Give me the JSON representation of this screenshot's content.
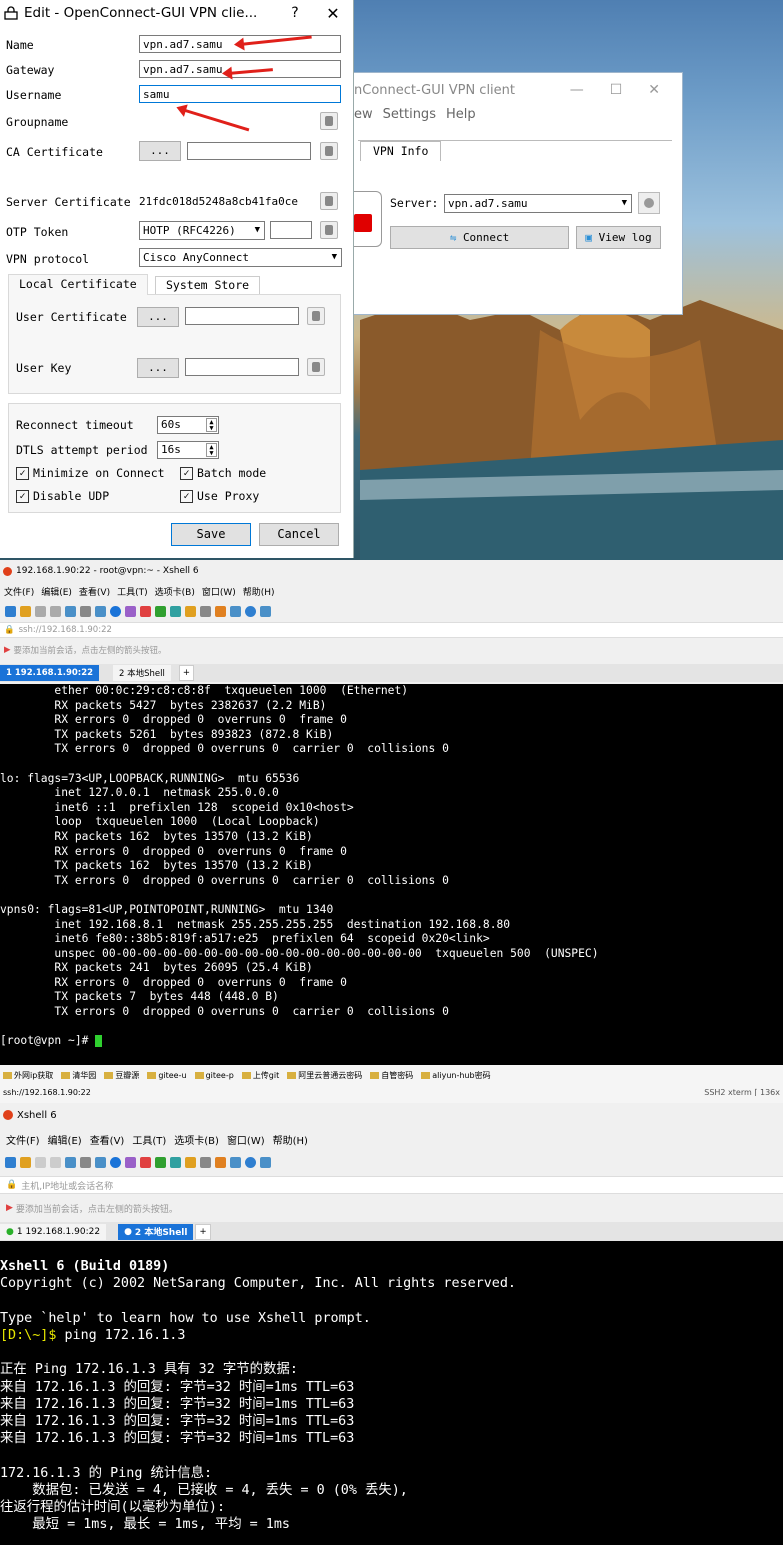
{
  "dialog": {
    "title": "Edit - OpenConnect-GUI VPN clie...",
    "help": "?",
    "close": "✕",
    "name_label": "Name",
    "name_value": "vpn.ad7.samu",
    "gateway_label": "Gateway",
    "gateway_value": "vpn.ad7.samu",
    "username_label": "Username",
    "username_value": "samu",
    "groupname_label": "Groupname",
    "ca_label": "CA Certificate",
    "browse": "...",
    "server_cert_label": "Server Certificate",
    "server_cert_value": "21fdc018d5248a8cb41fa0ce",
    "otp_label": "OTP Token",
    "otp_value": "HOTP (RFC4226)",
    "vpn_protocol_label": "VPN protocol",
    "vpn_protocol_value": "Cisco AnyConnect",
    "tab_local": "Local Certificate",
    "tab_system": "System Store",
    "user_cert_label": "User Certificate",
    "user_key_label": "User Key",
    "reconnect_label": "Reconnect timeout",
    "reconnect_value": "60s",
    "dtls_label": "DTLS attempt period",
    "dtls_value": "16s",
    "minimize_label": "Minimize on Connect",
    "batch_label": "Batch mode",
    "disable_udp_label": "Disable UDP",
    "use_proxy_label": "Use Proxy",
    "save": "Save",
    "cancel": "Cancel"
  },
  "client": {
    "title": "nConnect-GUI VPN client",
    "min": "—",
    "max": "☐",
    "close": "✕",
    "menu_view": "ew",
    "menu_settings": "Settings",
    "menu_help": "Help",
    "tab_vpn_info": "VPN Info",
    "server_label": "Server:",
    "server_value": "vpn.ad7.samu",
    "connect": "Connect",
    "view_log": "View log"
  },
  "xshell1": {
    "title": "192.168.1.90:22 - root@vpn:~ - Xshell 6",
    "menu": [
      "文件(F)",
      "编辑(E)",
      "查看(V)",
      "工具(T)",
      "选项卡(B)",
      "窗口(W)",
      "帮助(H)"
    ],
    "address": "ssh://192.168.1.90:22",
    "hint": "要添加当前会话，点击左侧的箭头按钮。",
    "tab1": "1 192.168.1.90:22",
    "tab2": "2 本地Shell",
    "add_tab": "+",
    "lines": [
      "        ether 00:0c:29:c8:c8:8f  txqueuelen 1000  (Ethernet)",
      "        RX packets 5427  bytes 2382637 (2.2 MiB)",
      "        RX errors 0  dropped 0  overruns 0  frame 0",
      "        TX packets 5261  bytes 893823 (872.8 KiB)",
      "        TX errors 0  dropped 0 overruns 0  carrier 0  collisions 0",
      "",
      "lo: flags=73<UP,LOOPBACK,RUNNING>  mtu 65536",
      "        inet 127.0.0.1  netmask 255.0.0.0",
      "        inet6 ::1  prefixlen 128  scopeid 0x10<host>",
      "        loop  txqueuelen 1000  (Local Loopback)",
      "        RX packets 162  bytes 13570 (13.2 KiB)",
      "        RX errors 0  dropped 0  overruns 0  frame 0",
      "        TX packets 162  bytes 13570 (13.2 KiB)",
      "        TX errors 0  dropped 0 overruns 0  carrier 0  collisions 0",
      "",
      "vpns0: flags=81<UP,POINTOPOINT,RUNNING>  mtu 1340",
      "        inet 192.168.8.1  netmask 255.255.255.255  destination 192.168.8.80",
      "        inet6 fe80::38b5:819f:a517:e25  prefixlen 64  scopeid 0x20<link>",
      "        unspec 00-00-00-00-00-00-00-00-00-00-00-00-00-00-00-00  txqueuelen 500  (UNSPEC)",
      "        RX packets 241  bytes 26095 (25.4 KiB)",
      "        RX errors 0  dropped 0  overruns 0  frame 0",
      "        TX packets 7  bytes 448 (448.0 B)",
      "        TX errors 0  dropped 0 overruns 0  carrier 0  collisions 0",
      "",
      "[root@vpn ~]# "
    ],
    "bookmarks": [
      "外网ip获取",
      "清华园",
      "豆瓣源",
      "gitee-u",
      "gitee-p",
      "上传git",
      "阿里云普通云密码",
      "自管密码",
      "aliyun-hub密码"
    ],
    "status_left": "ssh://192.168.1.90:22",
    "status_right": "SSH2   xterm   ⌈ 136x"
  },
  "xshell2": {
    "title": "Xshell 6",
    "menu": [
      "文件(F)",
      "编辑(E)",
      "查看(V)",
      "工具(T)",
      "选项卡(B)",
      "窗口(W)",
      "帮助(H)"
    ],
    "address": "主机,IP地址或会话名称",
    "hint": "要添加当前会话，点击左侧的箭头按钮。",
    "tab1": "1 192.168.1.90:22",
    "tab2": "2 本地Shell",
    "add_tab": "+",
    "banner1": "Xshell 6 (Build 0189)",
    "banner2": "Copyright (c) 2002 NetSarang Computer, Inc. All rights reserved.",
    "help_line": "Type `help' to learn how to use Xshell prompt.",
    "prompt": "[D:\\~]$",
    "command": " ping 172.16.1.3",
    "output": [
      "正在 Ping 172.16.1.3 具有 32 字节的数据:",
      "来自 172.16.1.3 的回复: 字节=32 时间=1ms TTL=63",
      "来自 172.16.1.3 的回复: 字节=32 时间=1ms TTL=63",
      "来自 172.16.1.3 的回复: 字节=32 时间=1ms TTL=63",
      "来自 172.16.1.3 的回复: 字节=32 时间=1ms TTL=63",
      "",
      "172.16.1.3 的 Ping 统计信息:",
      "    数据包: 已发送 = 4, 已接收 = 4, 丢失 = 0 (0% 丢失),",
      "往返行程的估计时间(以毫秒为单位):",
      "    最短 = 1ms, 最长 = 1ms, 平均 = 1ms"
    ]
  },
  "colors": {
    "prompt": "#e8e800",
    "accent": "#0078d7",
    "arrow": "#e0201a"
  }
}
